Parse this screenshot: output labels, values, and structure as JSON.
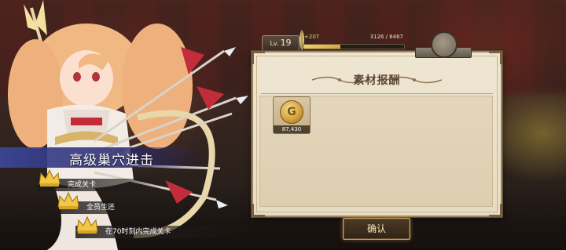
{
  "player": {
    "level_label": "Lv.",
    "level": "19",
    "exp_gain": "+207",
    "exp_text": "3126 / 8467",
    "exp_fraction": 0.369
  },
  "panel": {
    "title": "素材报酬",
    "rewards": [
      {
        "icon": "gold-coin-icon",
        "quantity": "87,430"
      }
    ]
  },
  "stage": {
    "title": "高级巢穴进击",
    "missions": [
      {
        "label": "完成关卡",
        "completed": true
      },
      {
        "label": "全员生还",
        "completed": true
      },
      {
        "label": "在70时刻内完成关卡",
        "completed": true
      }
    ]
  },
  "buttons": {
    "confirm_label": "确认"
  },
  "colors": {
    "accent_gold": "#d4a53c",
    "banner_blue": "#3c4696",
    "panel_bg": "#e6dcc5"
  }
}
